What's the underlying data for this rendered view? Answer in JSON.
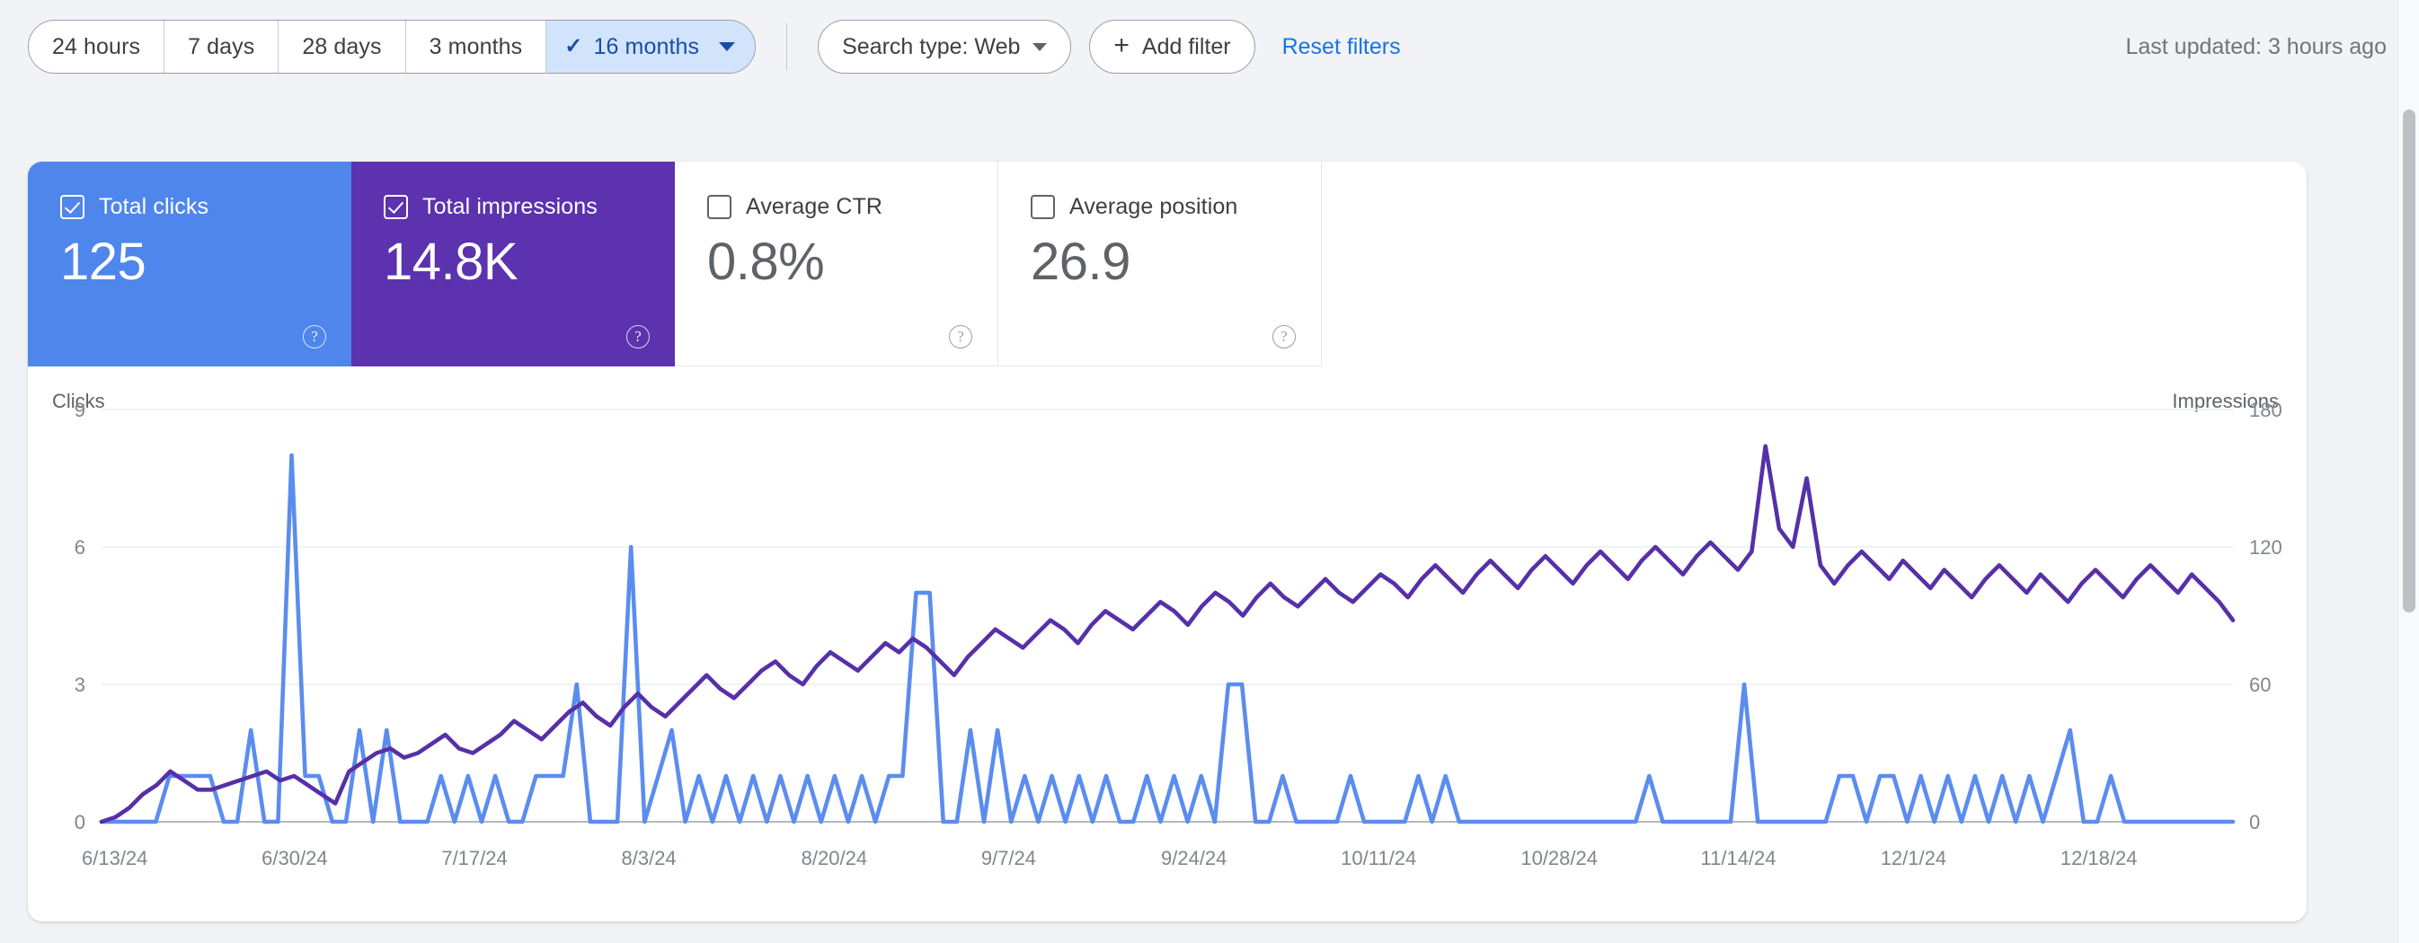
{
  "toolbar": {
    "date_range": {
      "options": [
        {
          "label": "24 hours",
          "selected": false
        },
        {
          "label": "7 days",
          "selected": false
        },
        {
          "label": "28 days",
          "selected": false
        },
        {
          "label": "3 months",
          "selected": false
        },
        {
          "label": "16 months",
          "selected": true
        }
      ],
      "check_glyph": "✓"
    },
    "search_type_label": "Search type: Web",
    "add_filter_label": "Add filter",
    "add_filter_glyph": "+",
    "reset_filters_label": "Reset filters",
    "last_updated": "Last updated: 3 hours ago"
  },
  "metrics": [
    {
      "label": "Total clicks",
      "value": "125",
      "checked": true,
      "color": "#4e86ec",
      "help": "?"
    },
    {
      "label": "Total impressions",
      "value": "14.8K",
      "checked": true,
      "color": "#5c32ae",
      "help": "?"
    },
    {
      "label": "Average CTR",
      "value": "0.8%",
      "checked": false,
      "color": "#ffffff",
      "help": "?"
    },
    {
      "label": "Average position",
      "value": "26.9",
      "checked": false,
      "color": "#ffffff",
      "help": "?"
    }
  ],
  "chart_data": {
    "type": "line",
    "title": "",
    "xlabel": "",
    "ylabel": "Clicks",
    "y2label": "Impressions",
    "ylim": [
      0,
      9
    ],
    "y2lim": [
      0,
      180
    ],
    "yticks": [
      "0",
      "3",
      "6",
      "9"
    ],
    "y2ticks": [
      "0",
      "60",
      "120",
      "180"
    ],
    "grid": true,
    "legend": "none",
    "xtick_labels": [
      "6/13/24",
      "6/30/24",
      "7/17/24",
      "8/3/24",
      "8/20/24",
      "9/7/24",
      "9/24/24",
      "10/11/24",
      "10/28/24",
      "11/14/24",
      "12/1/24",
      "12/18/24"
    ],
    "x_start": "6/13/24",
    "x_end": "12/31/24",
    "series": [
      {
        "name": "Clicks",
        "color": "#5b8def",
        "axis": "left",
        "values": [
          0,
          0,
          0,
          0,
          0,
          1,
          1,
          1,
          1,
          0,
          0,
          2,
          0,
          0,
          8,
          1,
          1,
          0,
          0,
          2,
          0,
          2,
          0,
          0,
          0,
          1,
          0,
          1,
          0,
          1,
          0,
          0,
          1,
          1,
          1,
          3,
          0,
          0,
          0,
          6,
          0,
          1,
          2,
          0,
          1,
          0,
          1,
          0,
          1,
          0,
          1,
          0,
          1,
          0,
          1,
          0,
          1,
          0,
          1,
          1,
          5,
          5,
          0,
          0,
          2,
          0,
          2,
          0,
          1,
          0,
          1,
          0,
          1,
          0,
          1,
          0,
          0,
          1,
          0,
          1,
          0,
          1,
          0,
          3,
          3,
          0,
          0,
          1,
          0,
          0,
          0,
          0,
          1,
          0,
          0,
          0,
          0,
          1,
          0,
          1,
          0,
          0,
          0,
          0,
          0,
          0,
          0,
          0,
          0,
          0,
          0,
          0,
          0,
          0,
          1,
          0,
          0,
          0,
          0,
          0,
          0,
          3,
          0,
          0,
          0,
          0,
          0,
          0,
          1,
          1,
          0,
          1,
          1,
          0,
          1,
          0,
          1,
          0,
          1,
          0,
          1,
          0,
          1,
          0,
          1,
          2,
          0,
          0,
          1,
          0,
          0,
          0,
          0,
          0,
          0,
          0,
          0,
          0
        ]
      },
      {
        "name": "Impressions",
        "color": "#5630a8",
        "axis": "right",
        "values": [
          0,
          2,
          6,
          12,
          16,
          22,
          18,
          14,
          14,
          16,
          18,
          20,
          22,
          18,
          20,
          16,
          12,
          8,
          22,
          26,
          30,
          32,
          28,
          30,
          34,
          38,
          32,
          30,
          34,
          38,
          44,
          40,
          36,
          42,
          48,
          52,
          46,
          42,
          50,
          56,
          50,
          46,
          52,
          58,
          64,
          58,
          54,
          60,
          66,
          70,
          64,
          60,
          68,
          74,
          70,
          66,
          72,
          78,
          74,
          80,
          76,
          70,
          64,
          72,
          78,
          84,
          80,
          76,
          82,
          88,
          84,
          78,
          86,
          92,
          88,
          84,
          90,
          96,
          92,
          86,
          94,
          100,
          96,
          90,
          98,
          104,
          98,
          94,
          100,
          106,
          100,
          96,
          102,
          108,
          104,
          98,
          106,
          112,
          106,
          100,
          108,
          114,
          108,
          102,
          110,
          116,
          110,
          104,
          112,
          118,
          112,
          106,
          114,
          120,
          114,
          108,
          116,
          122,
          116,
          110,
          118,
          164,
          128,
          120,
          150,
          112,
          104,
          112,
          118,
          112,
          106,
          114,
          108,
          102,
          110,
          104,
          98,
          106,
          112,
          106,
          100,
          108,
          102,
          96,
          104,
          110,
          104,
          98,
          106,
          112,
          106,
          100,
          108,
          102,
          96,
          88
        ]
      }
    ]
  },
  "scrollbar": {
    "present": true
  }
}
